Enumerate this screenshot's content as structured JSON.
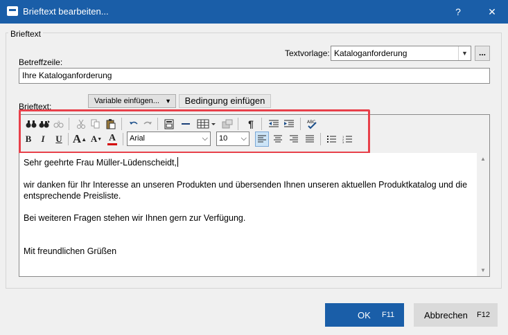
{
  "window": {
    "title": "Brieftext bearbeiten...",
    "help": "?",
    "close": "✕"
  },
  "group": {
    "legend": "Brieftext"
  },
  "template": {
    "label": "Textvorlage:",
    "value": "Kataloganforderung",
    "more": "..."
  },
  "subject": {
    "label": "Betreffzeile:",
    "value": "Ihre Kataloganforderung"
  },
  "body": {
    "label": "Brieftext:",
    "insert_variable": "Variable einfügen...",
    "insert_condition": "Bedingung einfügen"
  },
  "toolbar": {
    "font": "Arial",
    "size": "10",
    "spell_label": "ABC"
  },
  "content": {
    "salutation": "Sehr geehrte Frau Müller-Lüdenscheidt,",
    "paragraph1": "wir danken für Ihr Interesse an unseren Produkten und übersenden Ihnen unseren aktuellen Produktkatalog und die entsprechende Preisliste.",
    "paragraph2": "Bei weiteren Fragen stehen wir Ihnen gern zur Verfügung.",
    "closing": "Mit freundlichen Grüßen"
  },
  "buttons": {
    "ok": "OK",
    "ok_key": "F11",
    "cancel": "Abbrechen",
    "cancel_key": "F12"
  },
  "colors": {
    "accent": "#1a5ea8",
    "highlight": "#e8404a",
    "font_color_bar": "#d40000"
  }
}
